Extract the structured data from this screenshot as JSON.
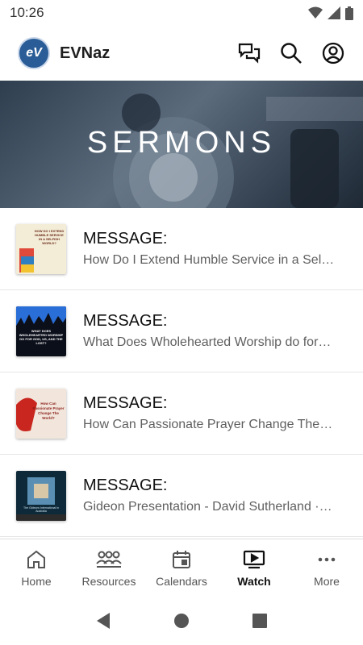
{
  "status": {
    "time": "10:26"
  },
  "app": {
    "title": "EVNaz",
    "logo_text": "eV"
  },
  "hero": {
    "title": "SERMONS"
  },
  "items": [
    {
      "heading": "MESSAGE:",
      "subtitle": "How Do I Extend Humble Service in a Sel…",
      "thumb_text": "HOW DO I EXTEND HUMBLE SERVICE IN A SELFISH WORLD?"
    },
    {
      "heading": "MESSAGE:",
      "subtitle": "What Does Wholehearted Worship do for…",
      "thumb_text": "WHAT DOES WHOLEHEARTED WORSHIP DO FOR GOD, US, AND THE LOST?"
    },
    {
      "heading": "MESSAGE:",
      "subtitle": "How Can Passionate Prayer Change The…",
      "thumb_text": "How Can Passionate Prayer Change The World?"
    },
    {
      "heading": "MESSAGE:",
      "subtitle": "Gideon Presentation - David Sutherland ·…",
      "thumb_text": "The Gideons International in Australia"
    }
  ],
  "nav": [
    {
      "label": "Home",
      "icon": "home-icon",
      "active": false
    },
    {
      "label": "Resources",
      "icon": "resources-icon",
      "active": false
    },
    {
      "label": "Calendars",
      "icon": "calendar-icon",
      "active": false
    },
    {
      "label": "Watch",
      "icon": "watch-icon",
      "active": true
    },
    {
      "label": "More",
      "icon": "more-icon",
      "active": false
    }
  ],
  "colors": {
    "brand": "#2a5d97",
    "active_text": "#111111",
    "inactive_text": "#555555"
  }
}
